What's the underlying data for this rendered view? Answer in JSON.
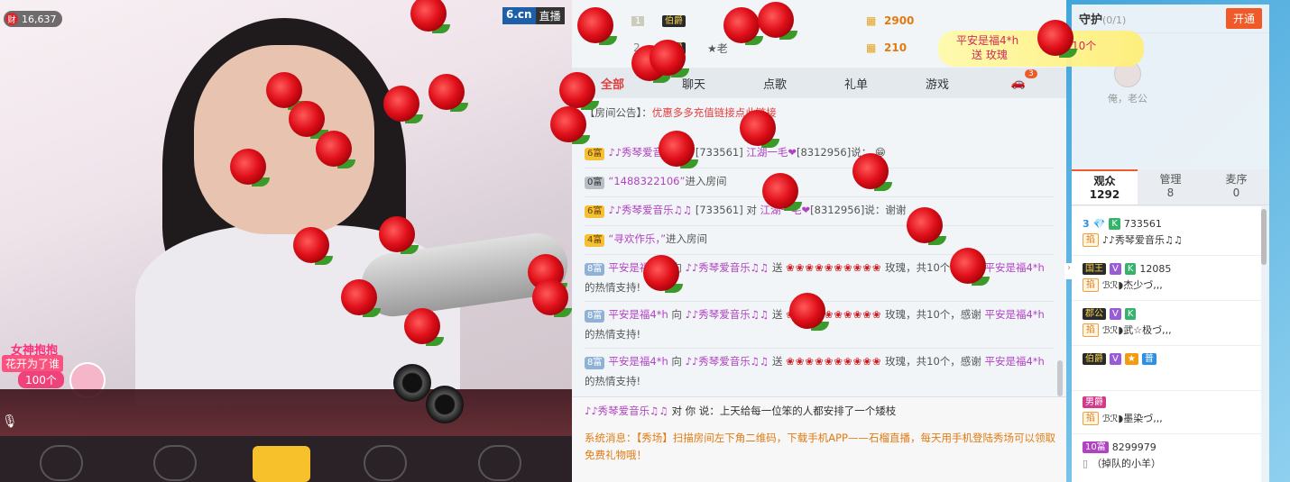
{
  "video": {
    "viewer_count": "16,637",
    "viewer_icon_label": "财",
    "brand": "6.cn",
    "brand_live": "直播",
    "goddess": {
      "title": "女神抱抱",
      "subtitle": "花开为了谁",
      "count": "100个"
    }
  },
  "ranking": [
    {
      "rank": "1",
      "title": "伯爵",
      "score": "2900"
    },
    {
      "rank": "2",
      "title": "伯爵",
      "name": "★老",
      "score": "210"
    }
  ],
  "gift_banner": {
    "user": "平安是福4*h",
    "action": "送 玫瑰",
    "count": "10个"
  },
  "tabs": [
    "全部",
    "聊天",
    "点歌",
    "礼单",
    "游戏"
  ],
  "tab_badge": "3",
  "chat": {
    "announcement_prefix": "【房间公告】：",
    "announcement": "优惠多多充值链接点此链接",
    "messages": [
      {
        "lv": "6富",
        "user": "♪♪秀琴爱音乐♫♫",
        "uid": "[733561]",
        "target": "江湖一毛❤",
        "tuid": "[8312956]",
        "text": "说："
      },
      {
        "lv": "0富",
        "user": "“1488322106”",
        "text": "进入房间"
      },
      {
        "lv": "6富",
        "user": "♪♪秀琴爱音乐♫♫",
        "uid": "[733561]",
        "mid": "对",
        "target": "江湖一毛❤",
        "tuid": "[8312956]",
        "text": "说：谢谢"
      },
      {
        "lv": "4富",
        "user": "“寻欢作乐，”",
        "text": "进入房间"
      }
    ],
    "gifts": [
      {
        "lv": "8富",
        "user": "平安是福4*h",
        "to": "向",
        "target": "♪♪秀琴爱音乐♫♫",
        "send": "送",
        "item": "玫瑰，共10个，感谢",
        "thanks_user": "平安是福4*h",
        "thanks": "的热情支持!"
      },
      {
        "lv": "8富",
        "user": "平安是福4*h",
        "to": "向",
        "target": "♪♪秀琴爱音乐♫♫",
        "send": "送",
        "item": "玫瑰，共10个，感谢",
        "thanks_user": "平安是福4*h",
        "thanks": "的热情支持!"
      },
      {
        "lv": "8富",
        "user": "平安是福4*h",
        "to": "向",
        "target": "♪♪秀琴爱音乐♫♫",
        "send": "送",
        "item": "玫瑰，共10个，感谢",
        "thanks_user": "平安是福4*h",
        "thanks": "的热情支持!"
      }
    ],
    "private_user": "♪♪秀琴爱音乐♫♫",
    "private_mid": "对 你 说：",
    "private_text": "上天给每一位笨的人都安排了一个矮枝",
    "system": "系统消息：【秀场】扫描房间左下角二维码，下载手机APP——石榴直播，每天用手机登陆秀场可以领取免费礼物哦！"
  },
  "guard": {
    "title": "守护",
    "count": "(0/1)",
    "open_label": "开通",
    "user_label": "俺，老公"
  },
  "audience_tabs": [
    {
      "label": "观众",
      "count": "1292"
    },
    {
      "label": "管理",
      "count": "8"
    },
    {
      "label": "麦序",
      "count": "0"
    }
  ],
  "audience": [
    {
      "level": "3",
      "badges": [
        "K"
      ],
      "id": "733561",
      "tag": "掐",
      "name": "♪♪秀琴爱音乐♫♫"
    },
    {
      "level": "国王",
      "badges": [
        "V",
        "K"
      ],
      "id": "12085",
      "tag": "掐",
      "name": "ℬℛ◗杰少づ,,,"
    },
    {
      "level": "郡公",
      "badges": [
        "V",
        "K"
      ],
      "id": "",
      "tag": "掐",
      "name": "ℬℛ◗武☆极づ,,,"
    },
    {
      "level": "伯爵",
      "badges": [
        "V",
        "★",
        "普"
      ],
      "id": "",
      "tag": "",
      "name": ""
    },
    {
      "level": "男爵",
      "badges": [],
      "id": "",
      "tag": "掐",
      "name": "ℬℛ◗墨染づ,,,"
    },
    {
      "level": "10富",
      "badges": [],
      "id": "8299979",
      "tag": "",
      "name": "（掉队的小羊）"
    }
  ],
  "colors": {
    "accent": "#e23c3c",
    "purple_user": "#b043c2",
    "system": "#e07b12",
    "open_button": "#f05a28"
  }
}
